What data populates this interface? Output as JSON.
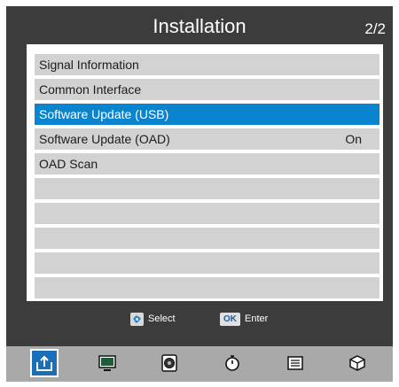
{
  "header": {
    "title": "Installation",
    "page": "2/2"
  },
  "menu": {
    "items": [
      {
        "label": "Signal Information",
        "value": "",
        "selected": false
      },
      {
        "label": "Common Interface",
        "value": "",
        "selected": false
      },
      {
        "label": "Software Update (USB)",
        "value": "",
        "selected": true
      },
      {
        "label": "Software Update (OAD)",
        "value": "On",
        "selected": false
      },
      {
        "label": "OAD Scan",
        "value": "",
        "selected": false
      },
      {
        "label": "",
        "value": "",
        "selected": false
      },
      {
        "label": "",
        "value": "",
        "selected": false
      },
      {
        "label": "",
        "value": "",
        "selected": false
      },
      {
        "label": "",
        "value": "",
        "selected": false
      },
      {
        "label": "",
        "value": "",
        "selected": false
      }
    ]
  },
  "hints": {
    "select_label": "Select",
    "ok_key": "OK",
    "enter_label": "Enter"
  },
  "dock": {
    "items": [
      {
        "name": "installation-icon",
        "active": true
      },
      {
        "name": "picture-icon",
        "active": false
      },
      {
        "name": "audio-icon",
        "active": false
      },
      {
        "name": "timer-icon",
        "active": false
      },
      {
        "name": "settings-list-icon",
        "active": false
      },
      {
        "name": "cube-icon",
        "active": false
      }
    ]
  },
  "colors": {
    "frame": "#3c3c3c",
    "row": "#d2d2d2",
    "highlight": "#0a84cf",
    "dock": "#a9a9a9",
    "dock_active": "#1a6fb8"
  }
}
